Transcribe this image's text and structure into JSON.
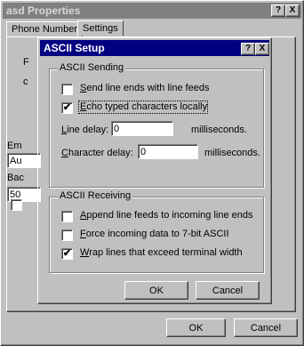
{
  "outer": {
    "title": "asd Properties",
    "help_btn": "?",
    "close_btn": "X",
    "tabs": [
      "Phone Number",
      "Settings"
    ],
    "panel_fragments": [
      "F",
      "c",
      "Em",
      "Au",
      "Bac",
      "50"
    ],
    "buttons": {
      "ok": "OK",
      "cancel": "Cancel"
    }
  },
  "dialog": {
    "title": "ASCII Setup",
    "help_btn": "?",
    "close_btn": "X",
    "sending": {
      "label": "ASCII Sending",
      "options": [
        {
          "text": "Send line ends with line feeds",
          "checked": false
        },
        {
          "text": "Echo typed characters locally",
          "checked": true
        }
      ],
      "line_delay": {
        "label": "Line delay:",
        "value": "0",
        "unit": "milliseconds."
      },
      "char_delay": {
        "label": "Character delay:",
        "value": "0",
        "unit": "milliseconds."
      }
    },
    "receiving": {
      "label": "ASCII Receiving",
      "options": [
        {
          "text": "Append line feeds to incoming line ends",
          "checked": false
        },
        {
          "text": "Force incoming data to 7-bit ASCII",
          "checked": false
        },
        {
          "text": "Wrap lines that exceed terminal width",
          "checked": true
        }
      ]
    },
    "buttons": {
      "ok": "OK",
      "cancel": "Cancel"
    },
    "check_mark": "✔"
  }
}
